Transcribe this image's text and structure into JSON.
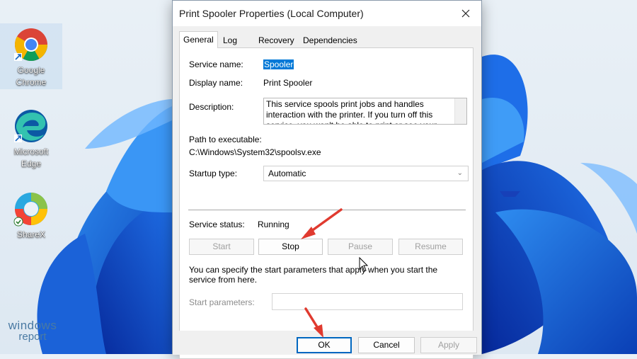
{
  "desktop": {
    "icons": [
      {
        "label_line1": "Google",
        "label_line2": "Chrome",
        "icon": "chrome-icon"
      },
      {
        "label_line1": "Microsoft",
        "label_line2": "Edge",
        "icon": "edge-icon"
      },
      {
        "label_line1": "ShareX",
        "label_line2": "",
        "icon": "sharex-icon"
      }
    ],
    "watermark": {
      "line1": "windows",
      "line2": "report"
    }
  },
  "dialog": {
    "title": "Print Spooler Properties (Local Computer)",
    "tabs": [
      "General",
      "Log On",
      "Recovery",
      "Dependencies"
    ],
    "active_tab": "General",
    "service_name_label": "Service name:",
    "service_name_value": "Spooler",
    "display_name_label": "Display name:",
    "display_name_value": "Print Spooler",
    "description_label": "Description:",
    "description_value": "This service spools print jobs and handles interaction with the printer.  If you turn off this service, you won't be able to print or see your printers.",
    "path_label": "Path to executable:",
    "path_value": "C:\\Windows\\System32\\spoolsv.exe",
    "startup_type_label": "Startup type:",
    "startup_type_value": "Automatic",
    "service_status_label": "Service status:",
    "service_status_value": "Running",
    "buttons": {
      "start": "Start",
      "stop": "Stop",
      "pause": "Pause",
      "resume": "Resume"
    },
    "start_params_note": "You can specify the start parameters that apply when you start the service from here.",
    "start_params_label": "Start parameters:",
    "start_params_value": "",
    "footer": {
      "ok": "OK",
      "cancel": "Cancel",
      "apply": "Apply"
    }
  },
  "colors": {
    "annotation_arrow": "#e03a2f",
    "primary_border": "#0067c0",
    "selection": "#0078d7"
  }
}
